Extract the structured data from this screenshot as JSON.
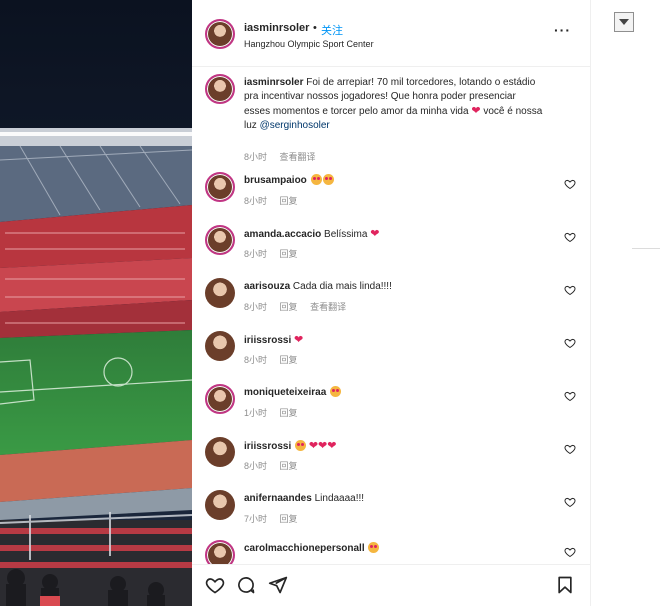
{
  "post": {
    "username": "iasminrsoler",
    "dot": "•",
    "follow_label": "关注",
    "location": "Hangzhou Olympic Sport Center",
    "more_label": "···"
  },
  "caption": {
    "username": "iasminrsoler",
    "text_before": "Foi de arrepiar! 70 mil torcedores, lotando o estádio pra incentivar nossos jogadores! Que honra poder presenciar esses momentos e torcer pelo amor da minha vida",
    "text_after": "você é nossa luz",
    "mention": "@serginhosoler",
    "time": "8小时",
    "translate_label": "查看翻译"
  },
  "comments": [
    {
      "user": "brusampaioo",
      "text": "",
      "emoji": "heart-eyes x2",
      "time": "8小时",
      "reply": "回复"
    },
    {
      "user": "amanda.accacio",
      "text": "Belíssima",
      "emoji": "red heart",
      "time": "8小时",
      "reply": "回复"
    },
    {
      "user": "aarisouza",
      "text": "Cada dia mais linda!!!!",
      "emoji": "",
      "time": "8小时",
      "reply": "回复",
      "translate": "查看翻译"
    },
    {
      "user": "iriissrossi",
      "text": "",
      "emoji": "red heart",
      "time": "8小时",
      "reply": "回复"
    },
    {
      "user": "moniqueteixeiraa",
      "text": "",
      "emoji": "heart-eyes",
      "time": "1小时",
      "reply": "回复"
    },
    {
      "user": "iriissrossi",
      "text": "",
      "emoji": "heart-eyes + 3 red hearts",
      "time": "8小时",
      "reply": "回复"
    },
    {
      "user": "anifernaandes",
      "text": "Lindaaaa!!!",
      "emoji": "",
      "time": "7小时",
      "reply": "回复"
    },
    {
      "user": "carolmacchionepersonall",
      "text": "",
      "emoji": "heart-eyes",
      "time": "",
      "reply": ""
    }
  ],
  "icons": {
    "like": "heart-outline-icon",
    "comment": "comment-bubble-icon",
    "share": "paper-plane-icon",
    "save": "bookmark-icon"
  },
  "colors": {
    "follow": "#0095f6",
    "mention": "#00376b",
    "heart": "#e0245e",
    "meta": "#8e8e8e"
  }
}
